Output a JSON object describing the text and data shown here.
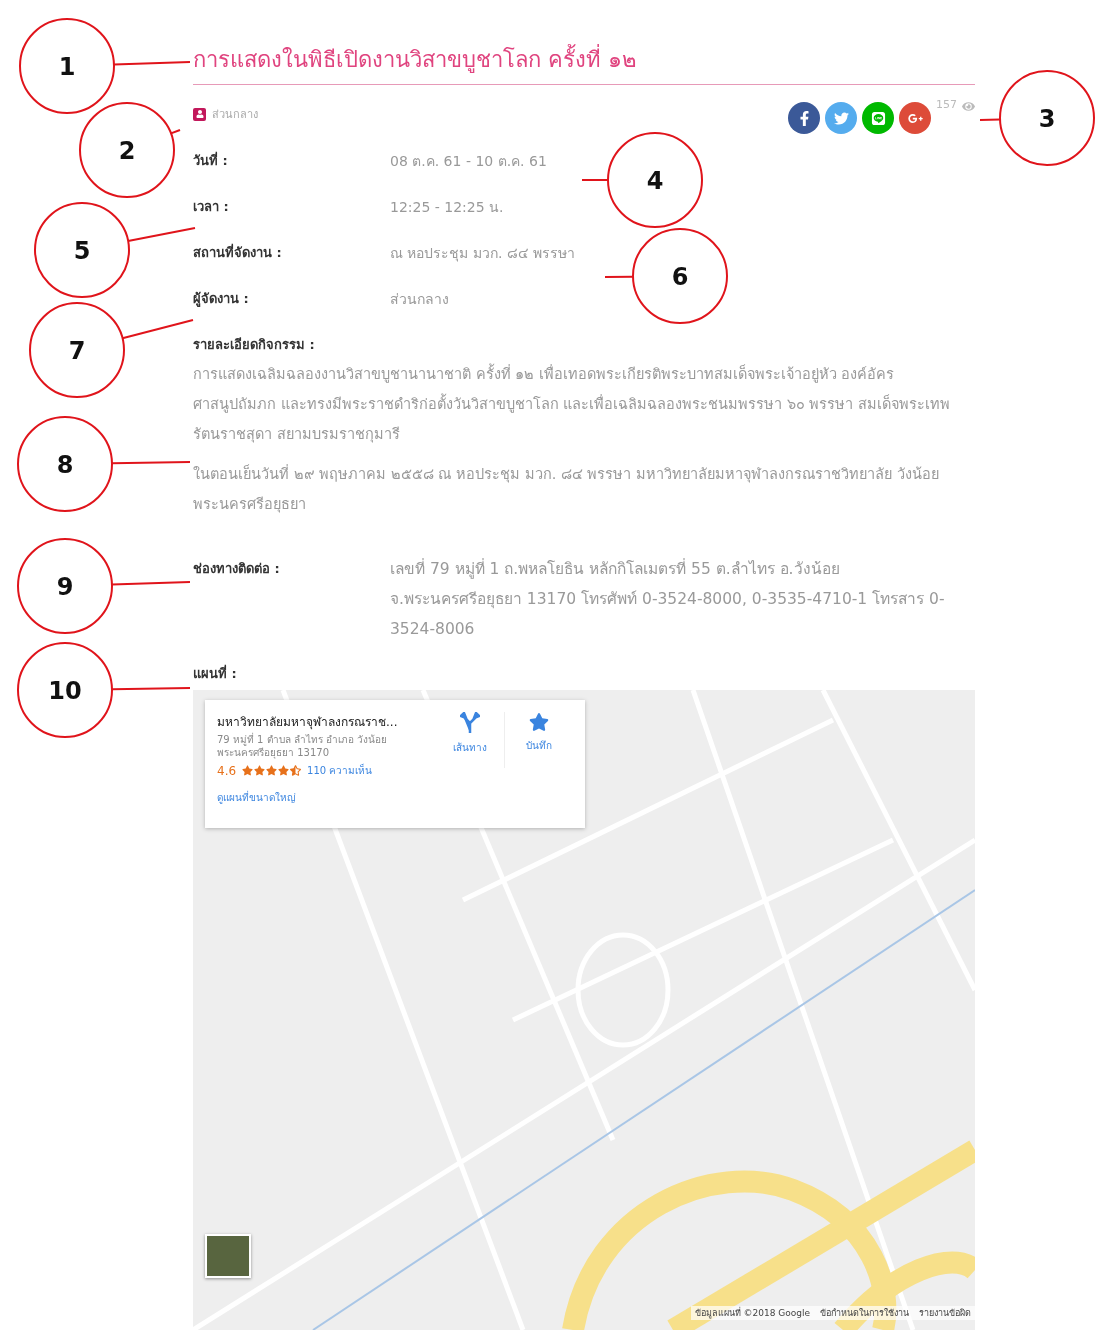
{
  "title": "การแสดงในพิธีเปิดงานวิสาขบูชาโลก ครั้งที่ ๑๒",
  "category": "ส่วนกลาง",
  "share_buttons": [
    {
      "kind": "facebook"
    },
    {
      "kind": "twitter"
    },
    {
      "kind": "line"
    },
    {
      "kind": "googleplus"
    }
  ],
  "view_count": "157",
  "details": [
    {
      "label": "วันที่ :",
      "value": "08 ต.ค. 61 - 10 ต.ค. 61"
    },
    {
      "label": "เวลา :",
      "value": "12:25 - 12:25 น."
    },
    {
      "label": "สถานที่จัดงาน :",
      "value": "ณ หอประชุม มวก. ๘๔ พรรษา"
    },
    {
      "label": "ผู้จัดงาน :",
      "value": "ส่วนกลาง"
    }
  ],
  "activity": {
    "label": "รายละเอียดกิจกรรม :",
    "paragraphs": [
      "การแสดงเฉลิมฉลองงานวิสาขบูชานานาชาติ ครั้งที่ ๑๒ เพื่อเทอดพระเกียรติพระบาทสมเด็จพระเจ้าอยู่หัว องค์อัครศาสนูปถัมภก และทรงมีพระราชดำริก่อตั้งวันวิสาขบูชาโลก และเพื่อเฉลิมฉลองพระชนมพรรษา ๖๐ พรรษา สมเด็จพระเทพรัตนราชสุดา สยามบรมราชกุมารี",
      "ในตอนเย็นวันที่ ๒๙ พฤษภาคม ๒๕๕๘ ณ หอประชุม มวก. ๘๔ พรรษา มหาวิทยาลัยมหาจุฬาลงกรณราชวิทยาลัย วังน้อย พระนครศรีอยุธยา"
    ]
  },
  "contact": {
    "label": "ช่องทางติดต่อ :",
    "value": "เลขที่ 79 หมู่ที่ 1 ถ.พหลโยธิน หลักกิโลเมตรที่ 55 ต.ลำไทร อ.วังน้อย จ.พระนครศรีอยุธยา 13170 โทรศัพท์ 0-3524-8000, 0-3535-4710-1 โทรสาร 0-3524-8006"
  },
  "map": {
    "label": "แผนที่ :",
    "place_card": {
      "name": "มหาวิทยาลัยมหาจุฬาลงกรณราช...",
      "address": "79 หมู่ที่ 1 ตำบล ลำไทร อำเภอ วังน้อย พระนครศรีอยุธยา 13170",
      "rating": "4.6",
      "stars": 4.5,
      "reviews": "110 ความเห็น",
      "larger_map_link": "ดูแผนที่ขนาดใหญ่",
      "actions": [
        "เส้นทาง",
        "บันทึก"
      ]
    },
    "footer": [
      "ข้อมูลแผนที่ ©2018 Google",
      "ข้อกำหนดในการใช้งาน",
      "รายงานข้อผิด"
    ]
  },
  "callouts": [
    "1",
    "2",
    "3",
    "4",
    "5",
    "6",
    "7",
    "8",
    "9",
    "10"
  ]
}
